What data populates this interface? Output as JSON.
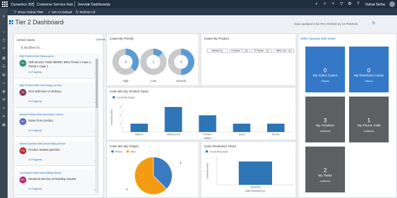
{
  "topbar": {
    "app": "Dynamics 365",
    "hub": "Customer Service Hub",
    "breadcrumb_area": "Service",
    "breadcrumb_sep": ">",
    "breadcrumb_page": "Dashboards",
    "user": "Vishal Sinha"
  },
  "cmdbar": {
    "show_global_filter": "Show Global Filter",
    "set_as_default": "Set As Default",
    "refresh_all": "Refresh All"
  },
  "dashboard": {
    "title": "Tier 2 Dashboard",
    "last_updated": "Data Updated: 8:52 PM | Refresh by 10 PM/2025"
  },
  "stream": {
    "title": "Active Cases",
    "options_label": "Options",
    "sort_label": "Modified On",
    "cases": [
      {
        "meta": "High   Problem   Web   Samsung xxx",
        "initials": "SC",
        "color": "#2a8f6b",
        "title": "Self Service Ticket 990001 9001 Portal 2 Case 1 Portal 2 Case 1",
        "status": "In Progress"
      },
      {
        "meta": "High   Problem   Web   Gulf Energy Lab Res",
        "initials": "IS",
        "color": "#8b3b5a",
        "title": "Item defective on delivery",
        "status": "In Progress"
      },
      {
        "meta": "Normal   Problem   Web   Ideal Bank Crest-Ex",
        "initials": "NC",
        "color": "#5a6ab8",
        "title": "Noise from product",
        "status": "In Progress"
      },
      {
        "meta": "Normal   Question   Web   Aerial Railing Service",
        "initials": "PQ",
        "color": "#b42e2e",
        "title": "Product related question",
        "status": "In Progress"
      },
      {
        "meta": "Low   Request   Web   Aerial Railing Service",
        "initials": "RC",
        "color": "#b92a78",
        "title": "Required Service scheduling request",
        "status": "In Progress"
      }
    ]
  },
  "priority": {
    "title": "Cases By Priority",
    "chart_data": {
      "type": "pie",
      "groups": [
        {
          "label": "High",
          "value": 3,
          "total": 8
        },
        {
          "label": "Low",
          "value": 1,
          "total": 8
        },
        {
          "label": "Normal",
          "value": 4,
          "total": 8
        }
      ]
    },
    "colors": {
      "value": "#5b9bd5",
      "rest": "#c8c9cb"
    }
  },
  "product": {
    "title": "Cases By Product",
    "chips": [
      "(blank) (1)",
      "Contoso T... (1)",
      "IO Syste... (1)",
      "Wild Lod... (1)"
    ]
  },
  "incident": {
    "title": "Case Mix (by Incident Type)",
    "legend": "Count:All (Case)",
    "chart_data": {
      "type": "bar",
      "categories": [
        "Malfunc",
        "Maintenance",
        "Problem",
        "Query",
        "Service"
      ],
      "values": [
        1,
        3,
        2,
        1,
        1
      ],
      "ylim": [
        0,
        3.5
      ],
      "xlabel": "Subject",
      "ylabel": "Count:All (Case)"
    },
    "color": "#2e75b6"
  },
  "origin": {
    "title": "Case Mix (By Origin)",
    "legend": [
      "Phone",
      "Web"
    ],
    "colors": [
      "#3a7ac2",
      "#f39c12"
    ],
    "chart_data": {
      "type": "pie",
      "categories": [
        "Phone",
        "Web"
      ],
      "values": [
        3,
        5
      ]
    },
    "labels": [
      "3",
      "5"
    ]
  },
  "resolution": {
    "title": "Case Resolution Trend",
    "legend": "Count:All (Case)",
    "chart_data": {
      "type": "bar",
      "categories": [
        "1/31/2018"
      ],
      "values": [
        8
      ],
      "ylim": [
        0,
        10
      ],
      "xlabel": "Date Resolved (m)",
      "ylabel": "Count:All (Case)"
    },
    "color": "#2e75b6"
  },
  "tiles": {
    "title": "Other Queues and Views",
    "items": [
      {
        "num": "0",
        "label": "My Active Cases",
        "sub": "Filtered",
        "color": "blue"
      },
      {
        "num": "0",
        "label": "My Resolved Cases",
        "sub": "Filtered",
        "color": "blue"
      },
      {
        "num": "3",
        "label": "My Activities",
        "sub": "Unfiltered",
        "color": "gray"
      },
      {
        "num": "1",
        "label": "My Phone Calls",
        "sub": "Unfiltered",
        "color": "gray"
      },
      {
        "num": "2",
        "label": "My Tasks",
        "sub": "Unfiltered",
        "color": "gray"
      }
    ]
  }
}
